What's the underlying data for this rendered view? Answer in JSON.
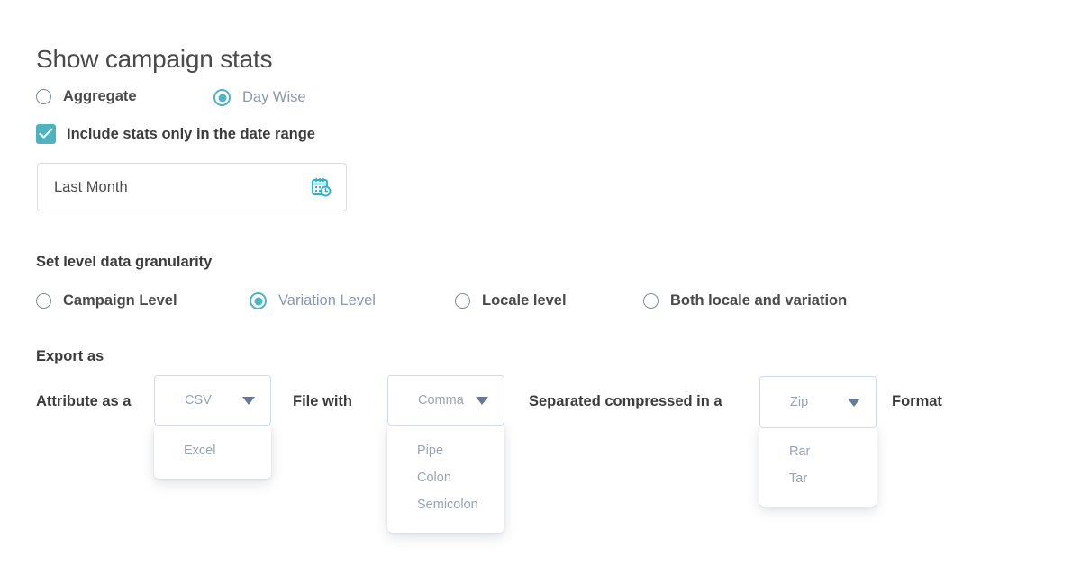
{
  "page": {
    "title": "Show campaign stats"
  },
  "stats_mode": {
    "options": [
      {
        "label": "Aggregate",
        "selected": false
      },
      {
        "label": "Day Wise",
        "selected": true
      }
    ]
  },
  "date_range_checkbox": {
    "label": "Include stats only in the date range",
    "checked": true,
    "icon": "check-icon"
  },
  "date_field": {
    "value": "Last Month",
    "icon": "calendar-clock-icon"
  },
  "granularity": {
    "title": "Set level data granularity",
    "options": [
      {
        "label": "Campaign Level",
        "selected": false
      },
      {
        "label": "Variation Level",
        "selected": true
      },
      {
        "label": "Locale level",
        "selected": false
      },
      {
        "label": "Both locale and variation",
        "selected": false
      }
    ]
  },
  "export": {
    "title": "Export as",
    "label_1": "Attribute as a",
    "label_2": "File with",
    "label_3": "Separated compressed in a",
    "label_4": "Format",
    "file_type": {
      "selected": "CSV",
      "open": true,
      "options": [
        "Excel"
      ]
    },
    "separator": {
      "selected": "Comma",
      "open": true,
      "options": [
        "Pipe",
        "Colon",
        "Semicolon"
      ]
    },
    "archive": {
      "selected": "Zip",
      "open": true,
      "options": [
        "Rar",
        "Tar"
      ]
    }
  },
  "colors": {
    "accent_teal": "#4fb3bf",
    "muted_text": "#8d97ab",
    "dark_text": "#3c3c3c",
    "dropdown_border": "#cfdcf0",
    "arrow": "#667a9b"
  }
}
